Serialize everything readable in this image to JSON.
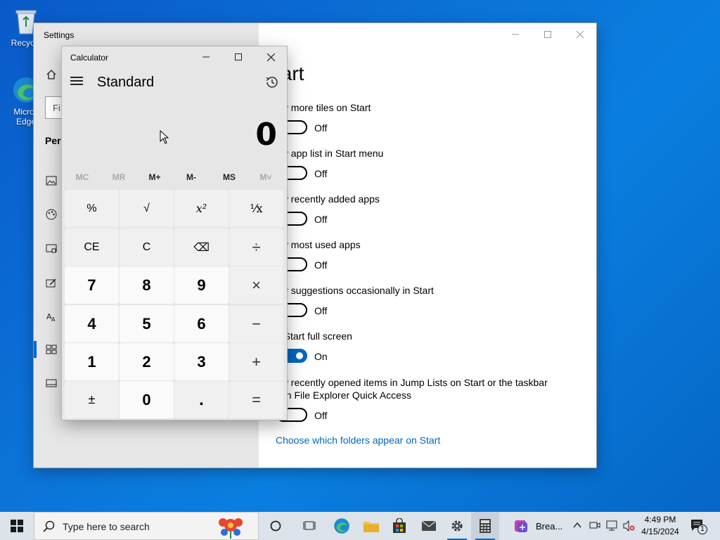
{
  "desktop": {
    "icons": [
      {
        "label": "Recycle"
      },
      {
        "label": "Micros Edge"
      }
    ]
  },
  "settings": {
    "title": "Settings",
    "page_title": "tart",
    "search_partial": "Fi",
    "section_partial": "Pers",
    "options": [
      {
        "label": "ow more tiles on Start",
        "state": "Off"
      },
      {
        "label": "ow app list in Start menu",
        "state": "Off"
      },
      {
        "label": "ow recently added apps",
        "state": "Off"
      },
      {
        "label": "ow most used apps",
        "state": "Off"
      },
      {
        "label": "ow suggestions occasionally in Start",
        "state": "Off"
      },
      {
        "label": "e Start full screen",
        "state": "On"
      },
      {
        "label": "ow recently opened items in Jump Lists on Start or the taskbar",
        "label2": "d in File Explorer Quick Access",
        "state": "Off"
      }
    ],
    "link": "Choose which folders appear on Start"
  },
  "calculator": {
    "title": "Calculator",
    "mode": "Standard",
    "display": "0",
    "memory": [
      "MC",
      "MR",
      "M+",
      "M-",
      "MS",
      "M˅"
    ],
    "keys": [
      [
        "%",
        "√",
        "x²",
        "¹⁄x"
      ],
      [
        "CE",
        "C",
        "⌫",
        "÷"
      ],
      [
        "7",
        "8",
        "9",
        "×"
      ],
      [
        "4",
        "5",
        "6",
        "−"
      ],
      [
        "1",
        "2",
        "3",
        "+"
      ],
      [
        "±",
        "0",
        ".",
        "="
      ]
    ]
  },
  "taskbar": {
    "search_placeholder": "Type here to search",
    "running_app_label": "Brea...",
    "time": "4:49 PM",
    "date": "4/15/2024",
    "notification_count": "1"
  },
  "colors": {
    "accent": "#0067c0",
    "desktop_blue": "#0a74d8"
  }
}
